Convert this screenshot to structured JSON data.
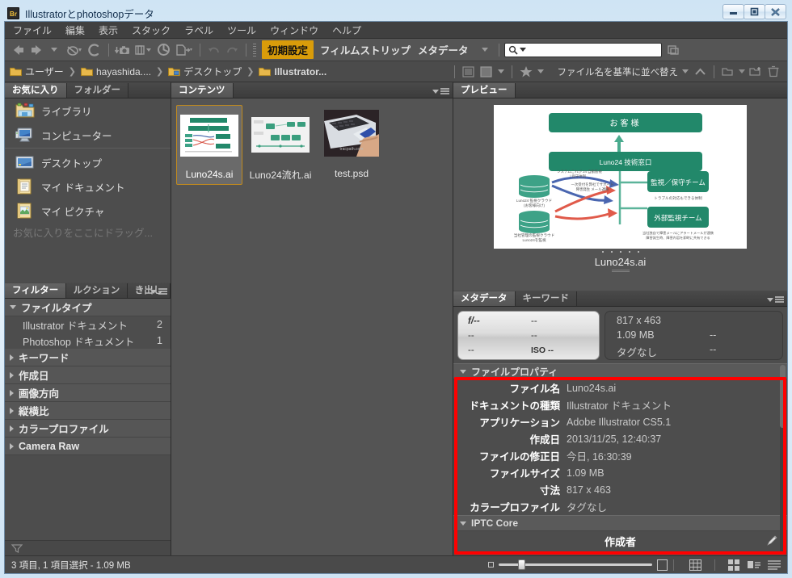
{
  "window": {
    "title": "Illustratorとphotoshopデータ",
    "app_badge": "Br",
    "minimize_label": "最小化",
    "maximize_label": "最大化",
    "close_label": "閉じる"
  },
  "menubar": {
    "items": [
      {
        "label": "ファイル",
        "name": "menu-file"
      },
      {
        "label": "編集",
        "name": "menu-edit"
      },
      {
        "label": "表示",
        "name": "menu-view"
      },
      {
        "label": "スタック",
        "name": "menu-stacks"
      },
      {
        "label": "ラベル",
        "name": "menu-label"
      },
      {
        "label": "ツール",
        "name": "menu-tools"
      },
      {
        "label": "ウィンドウ",
        "name": "menu-window"
      },
      {
        "label": "ヘルプ",
        "name": "menu-help"
      }
    ]
  },
  "toolbar": {
    "workspace_active": "初期設定",
    "workspace_items": [
      "フィルムストリップ",
      "メタデータ"
    ],
    "search_placeholder": "",
    "search_value": ""
  },
  "breadcrumb": {
    "items": [
      {
        "label": "ユーザー",
        "bold": false
      },
      {
        "label": "hayashida....",
        "bold": false
      },
      {
        "label": "デスクトップ",
        "bold": false
      },
      {
        "label": "Illustrator...",
        "bold": true
      }
    ],
    "sort_label": "ファイル名を基準に並べ替え"
  },
  "favorites": {
    "tabs": [
      {
        "label": "お気に入り",
        "active": true
      },
      {
        "label": "フォルダー",
        "active": false
      }
    ],
    "group_one": [
      {
        "label": "ライブラリ",
        "icon": "library-folder-icon"
      },
      {
        "label": "コンピューター",
        "icon": "computer-icon"
      }
    ],
    "group_two": [
      {
        "label": "デスクトップ",
        "icon": "desktop-icon"
      },
      {
        "label": "マイ ドキュメント",
        "icon": "documents-folder-icon"
      },
      {
        "label": "マイ ピクチャ",
        "icon": "pictures-folder-icon"
      }
    ],
    "hint": "お気に入りをここにドラッグ..."
  },
  "filter": {
    "tabs": [
      {
        "label": "フィルター",
        "active": true
      },
      {
        "label": "ルクション",
        "active": false
      },
      {
        "label": "き出し",
        "active": false
      }
    ],
    "sections": [
      {
        "label": "ファイルタイプ",
        "expanded": true,
        "items": [
          {
            "label": "Illustrator ドキュメント",
            "count": "2"
          },
          {
            "label": "Photoshop ドキュメント",
            "count": "1"
          }
        ]
      },
      {
        "label": "キーワード",
        "expanded": false,
        "items": []
      },
      {
        "label": "作成日",
        "expanded": false,
        "items": []
      },
      {
        "label": "画像方向",
        "expanded": false,
        "items": []
      },
      {
        "label": "縦横比",
        "expanded": false,
        "items": []
      },
      {
        "label": "カラープロファイル",
        "expanded": false,
        "items": []
      },
      {
        "label": "Camera Raw",
        "expanded": false,
        "items": []
      }
    ]
  },
  "content": {
    "tabs": [
      {
        "label": "コンテンツ",
        "active": true
      }
    ],
    "items": [
      {
        "name": "Luno24s.ai",
        "type": "diagram",
        "selected": true
      },
      {
        "name": "Luno24流れ.ai",
        "type": "flow",
        "selected": false
      },
      {
        "name": "test.psd",
        "type": "photo",
        "selected": false
      }
    ]
  },
  "preview": {
    "tabs": [
      {
        "label": "プレビュー",
        "active": true
      }
    ],
    "caption": "Luno24s.ai",
    "diagram": {
      "accent_color": "#22886a",
      "top_box": "お客様",
      "second_box": "Luno24 技術窓口",
      "right_box_1": "監視／保守チーム",
      "right_box_1_note": "トラブルの対応もできる体制",
      "right_box_2": "外部監視チーム",
      "right_box_2_note": "当社独自で障害メールにアラートメールが連携\n障害発生時、障害内容を即時に共有できる",
      "left_label_1": "Luno24 監視クラウド\n(お客様向け)",
      "left_label_2": "当社管理の監視クラウド\nLuno24を監視",
      "arrow_note_1": "システムこれが 24 自動監視\n/ 保守体制",
      "arrow_note_2": "一次受付を弊社でサポート\n障害発生 メール連絡"
    }
  },
  "metadata": {
    "tabs": [
      {
        "label": "メタデータ",
        "active": true
      },
      {
        "label": "キーワード",
        "active": false
      }
    ],
    "placard_camera": {
      "aperture": "f/--",
      "shutter": "--",
      "row2_left": "--",
      "row2_right": "--",
      "row3_left": "--",
      "iso": "ISO --"
    },
    "placard_file": {
      "dimensions": "817 x 463",
      "size": "1.09 MB",
      "profile": "タグなし",
      "col2_row1": "",
      "col2_row2": "--",
      "col2_row3": "--"
    },
    "sections": [
      {
        "label": "ファイルプロパティ",
        "expanded": true,
        "rows": [
          {
            "key": "ファイル名",
            "value": "Luno24s.ai"
          },
          {
            "key": "ドキュメントの種類",
            "value": "Illustrator ドキュメント"
          },
          {
            "key": "アプリケーション",
            "value": "Adobe Illustrator CS5.1"
          },
          {
            "key": "作成日",
            "value": "2013/11/25, 12:40:37"
          },
          {
            "key": "ファイルの修正日",
            "value": "今日, 16:30:39"
          },
          {
            "key": "ファイルサイズ",
            "value": "1.09 MB"
          },
          {
            "key": "寸法",
            "value": "817 x 463"
          },
          {
            "key": "カラープロファイル",
            "value": "タグなし"
          }
        ]
      }
    ],
    "iptc": {
      "label": "IPTC Core",
      "row_label": "作成者"
    }
  },
  "statusbar": {
    "text": "3 項目, 1 項目選択 - 1.09 MB"
  }
}
